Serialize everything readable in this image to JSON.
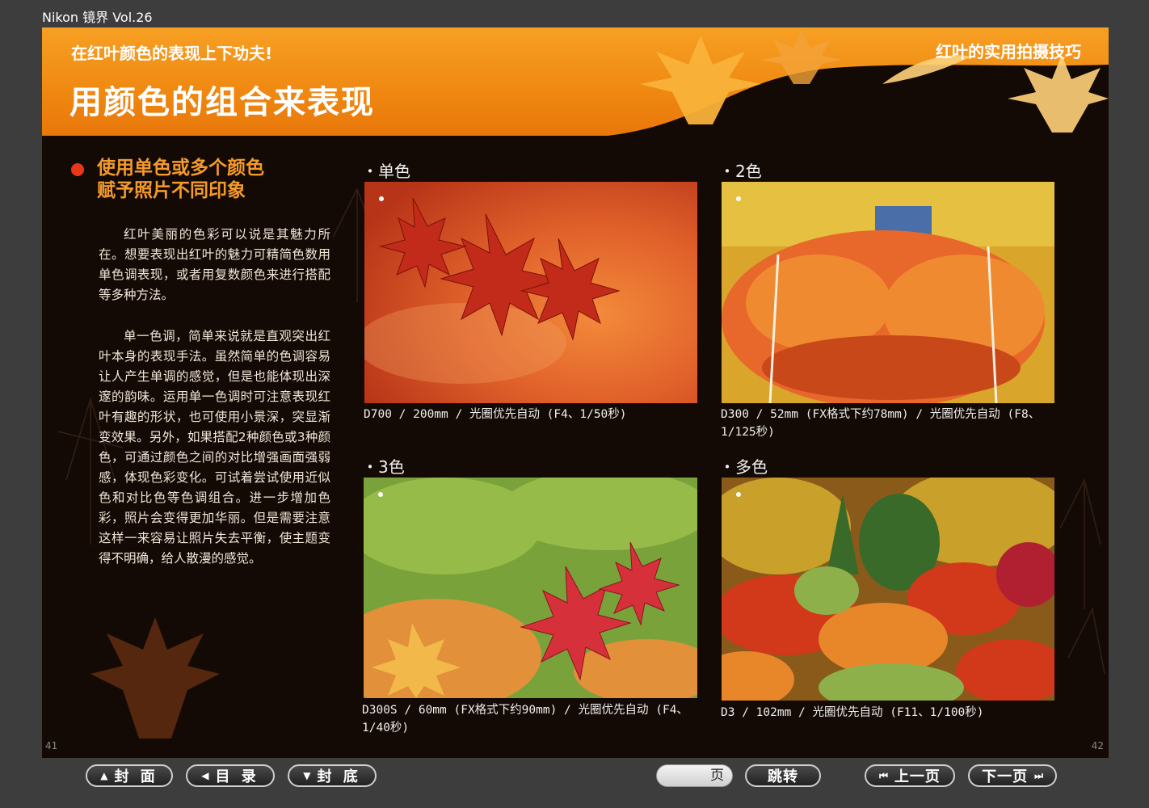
{
  "window": {
    "title": "Nikon 镜界 Vol.26"
  },
  "banner": {
    "subtitle": "在红叶颜色的表现上下功夫!",
    "title": "用颜色的组合来表现",
    "series": "红叶的实用拍摄技巧"
  },
  "article": {
    "heading_line1": "使用单色或多个颜色",
    "heading_line2": "赋予照片不同印象",
    "para1": "红叶美丽的色彩可以说是其魅力所在。想要表现出红叶的魅力可精简色数用单色调表现，或者用复数颜色来进行搭配等多种方法。",
    "para2": "单一色调，简单来说就是直观突出红叶本身的表现手法。虽然简单的色调容易让人产生单调的感觉，但是也能体现出深邃的韵味。运用单一色调时可注意表现红叶有趣的形状，也可使用小景深，突显渐变效果。另外，如果搭配2种颜色或3种颜色，可通过颜色之间的对比增强画面强弱感，体现色彩变化。可试着尝试使用近似色和对比色等色调组合。进一步增加色彩，照片会变得更加华丽。但是需要注意这样一来容易让照片失去平衡，使主题变得不明确，给人散漫的感觉。"
  },
  "photos": [
    {
      "label": "・单色",
      "caption": "D700 / 200mm / 光圈优先自动 (F4、1/50秒)"
    },
    {
      "label": "・2色",
      "caption": "D300 / 52mm (FX格式下约78mm) / 光圈优先自动 (F8、1/125秒)"
    },
    {
      "label": "・3色",
      "caption": "D300S / 60mm (FX格式下约90mm) / 光圈优先自动 (F4、1/40秒)"
    },
    {
      "label": "・多色",
      "caption": "D3 / 102mm / 光圈优先自动 (F11、1/100秒)"
    }
  ],
  "page_numbers": {
    "left": "41",
    "right": "42"
  },
  "nav": {
    "cover": "封 面",
    "toc": "目 录",
    "back_cover": "封 底",
    "page_field": "页",
    "jump": "跳转",
    "prev": "上一页",
    "next": "下一页"
  },
  "icons": {
    "cover": "triangle-up-icon",
    "toc": "triangle-left-icon",
    "back_cover": "triangle-down-icon",
    "prev": "skip-back-icon",
    "next": "skip-forward-icon"
  },
  "colors": {
    "banner": "#f08a12",
    "background": "#140a05",
    "heading": "#f39a2c",
    "bullet": "#e8381a"
  }
}
